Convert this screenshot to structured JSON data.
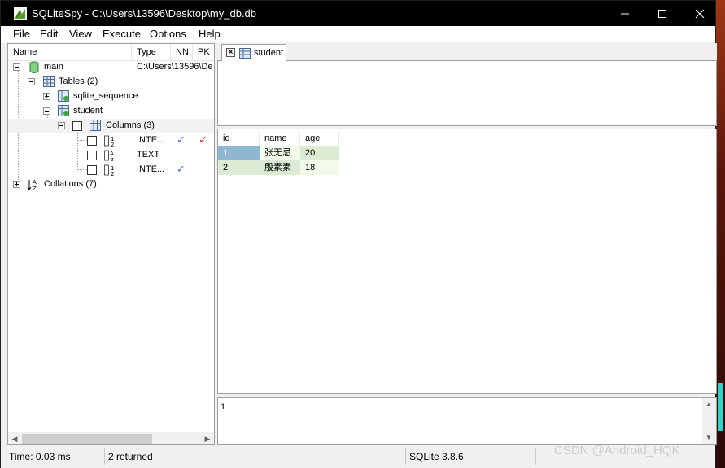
{
  "window": {
    "title": "SQLiteSpy - C:\\Users\\13596\\Desktop\\my_db.db",
    "minimize_icon": "minimize-icon",
    "maximize_icon": "maximize-icon",
    "close_icon": "close-icon"
  },
  "menu": [
    "File",
    "Edit",
    "View",
    "Execute",
    "Options",
    "Help"
  ],
  "schema_tree": {
    "columns": [
      "Name",
      "Type",
      "NN",
      "PK"
    ],
    "main": {
      "label": "main",
      "type": "C:\\Users\\13596\\De"
    },
    "tables": {
      "label": "Tables (2)"
    },
    "sqlite_sequence": {
      "label": "sqlite_sequence"
    },
    "student": {
      "label": "student"
    },
    "columns_node": {
      "label": "Columns (3)"
    },
    "fields": [
      {
        "type": "INTE...",
        "nn": "✓",
        "pk": "✓"
      },
      {
        "type": "TEXT",
        "nn": "",
        "pk": ""
      },
      {
        "type": "INTE...",
        "nn": "✓",
        "pk": ""
      }
    ],
    "collations": {
      "label": "Collations (7)"
    }
  },
  "tabs": [
    {
      "label": "student"
    }
  ],
  "results": {
    "headers": [
      "id",
      "name",
      "age"
    ],
    "rows": [
      [
        "1",
        "张无忌",
        "20"
      ],
      [
        "2",
        "殷素素",
        "18"
      ]
    ]
  },
  "message_box": {
    "text": "1"
  },
  "status": {
    "time": "Time: 0.03 ms",
    "returned": "2 returned",
    "version": "SQLite 3.8.6"
  },
  "watermark": "CSDN @Android_HQK",
  "colors": {
    "titlebar": "#000000",
    "selected_cell": "#8fb7d1",
    "row_even": "#dcebd3",
    "row_odd": "#f2fbe9",
    "check_blue": "#3f6fcf",
    "check_red": "#e02020"
  }
}
